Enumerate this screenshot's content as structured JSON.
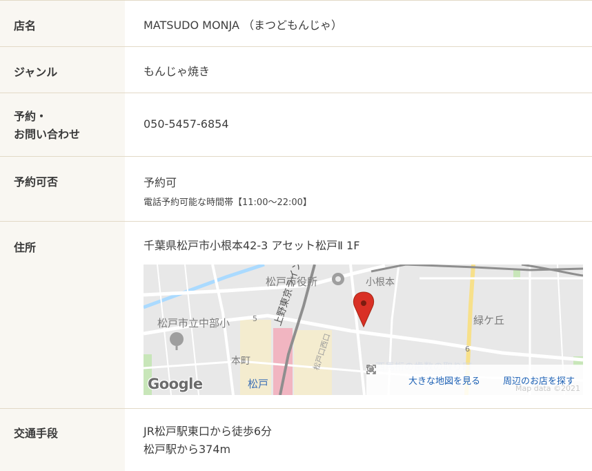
{
  "rows": [
    {
      "label": "店名",
      "value": "MATSUDO MONJA （まつどもんじゃ）"
    },
    {
      "label": "ジャンル",
      "value": "もんじゃ焼き"
    },
    {
      "label_lines": [
        "予約・",
        "お問い合わせ"
      ],
      "value": "050-5457-6854"
    },
    {
      "label": "予約可否",
      "value": "予約可",
      "note": "電話予約可能な時間帯【11:00〜22:00】"
    },
    {
      "label": "住所",
      "value": "千葉県松戸市小根本42-3 アセット松戸Ⅱ 1F"
    },
    {
      "label": "交通手段",
      "value_lines": [
        "JR松戸駅東口から徒歩6分",
        "松戸駅から374m"
      ]
    }
  ],
  "map": {
    "labels": {
      "city_hall": "松戸市役所",
      "konemoto": "小根本",
      "midorigaoka": "緑ケ丘",
      "school": "松戸市立中部小",
      "honcho": "本町",
      "line": "上野東京ライン",
      "station": "松戸",
      "faded_label": "西馬桁の歯数の取り町",
      "road_label": "松戸口西口"
    },
    "big_map_label": "大きな地図を見る",
    "nearby_label": "周辺のお店を探す",
    "logo": "Google",
    "attribution": "Map data ©2021",
    "route_badges": [
      "5",
      "6"
    ],
    "colors": {
      "pin": "#d93025",
      "road": "#ffffff",
      "rail": "#8e8e8e",
      "green": "#c8e6b9",
      "water": "#aadaff",
      "yellow": "#f7e08a",
      "pink": "#f4a4b4"
    }
  }
}
